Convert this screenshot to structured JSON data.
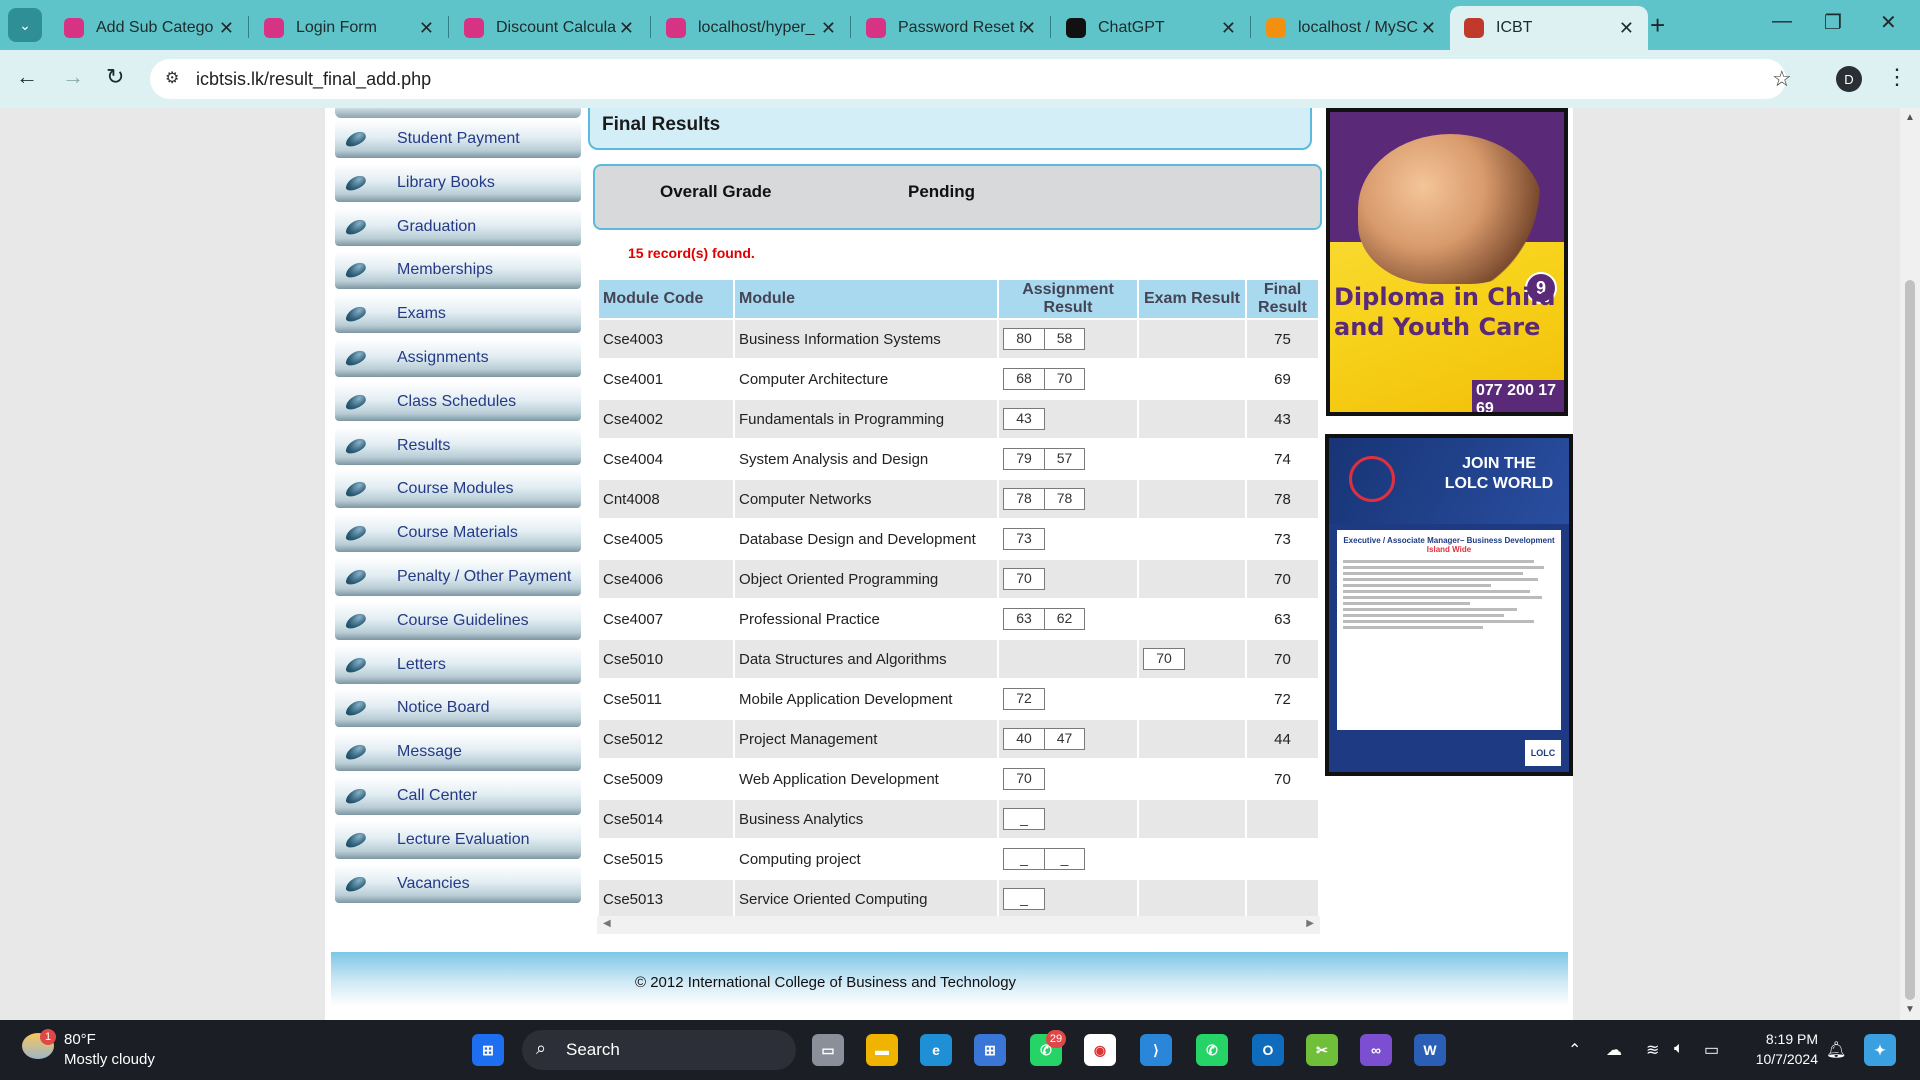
{
  "browser": {
    "tabs": [
      {
        "title": "Add Sub Catego",
        "icon": "admin-icon",
        "color": "#d63384"
      },
      {
        "title": "Login Form",
        "icon": "admin-icon",
        "color": "#d63384"
      },
      {
        "title": "Discount Calcula",
        "icon": "admin-icon",
        "color": "#d63384"
      },
      {
        "title": "localhost/hyper_",
        "icon": "admin-icon",
        "color": "#d63384"
      },
      {
        "title": "Password Reset F",
        "icon": "admin-icon",
        "color": "#d63384"
      },
      {
        "title": "ChatGPT",
        "icon": "chatgpt-icon",
        "color": "#111111"
      },
      {
        "title": "localhost / MySC",
        "icon": "phpmyadmin-icon",
        "color": "#f29111"
      },
      {
        "title": "ICBT",
        "icon": "icbt-icon",
        "color": "#c0392b"
      }
    ],
    "url": "icbtsis.lk/result_final_add.php",
    "profile_initial": "D"
  },
  "sidebar": {
    "items": [
      {
        "label": "Student Payment"
      },
      {
        "label": "Library Books"
      },
      {
        "label": "Graduation"
      },
      {
        "label": "Memberships"
      },
      {
        "label": "Exams"
      },
      {
        "label": "Assignments"
      },
      {
        "label": "Class Schedules"
      },
      {
        "label": "Results"
      },
      {
        "label": "Course Modules"
      },
      {
        "label": "Course Materials"
      },
      {
        "label": "Penalty / Other Payment"
      },
      {
        "label": "Course Guidelines"
      },
      {
        "label": "Letters"
      },
      {
        "label": "Notice Board"
      },
      {
        "label": "Message"
      },
      {
        "label": "Call Center"
      },
      {
        "label": "Lecture Evaluation"
      },
      {
        "label": "Vacancies"
      }
    ]
  },
  "main": {
    "title": "Final Results",
    "overall_grade_label": "Overall Grade",
    "overall_grade_value": "Pending",
    "records_found": "15 record(s) found.",
    "columns": [
      "Module Code",
      "Module",
      "Assignment Result",
      "Exam Result",
      "Final Result"
    ],
    "rows": [
      {
        "code": "Cse4003",
        "module": "Business Information Systems",
        "assignment": [
          "80",
          "58"
        ],
        "exam": [],
        "final": "75"
      },
      {
        "code": "Cse4001",
        "module": "Computer Architecture",
        "assignment": [
          "68",
          "70"
        ],
        "exam": [],
        "final": "69"
      },
      {
        "code": "Cse4002",
        "module": "Fundamentals in Programming",
        "assignment": [
          "43"
        ],
        "exam": [],
        "final": "43"
      },
      {
        "code": "Cse4004",
        "module": "System Analysis and Design",
        "assignment": [
          "79",
          "57"
        ],
        "exam": [],
        "final": "74"
      },
      {
        "code": "Cnt4008",
        "module": "Computer Networks",
        "assignment": [
          "78",
          "78"
        ],
        "exam": [],
        "final": "78"
      },
      {
        "code": "Cse4005",
        "module": "Database Design and Development",
        "assignment": [
          "73"
        ],
        "exam": [],
        "final": "73"
      },
      {
        "code": "Cse4006",
        "module": "Object Oriented Programming",
        "assignment": [
          "70"
        ],
        "exam": [],
        "final": "70"
      },
      {
        "code": "Cse4007",
        "module": "Professional Practice",
        "assignment": [
          "63",
          "62"
        ],
        "exam": [],
        "final": "63"
      },
      {
        "code": "Cse5010",
        "module": "Data Structures and Algorithms",
        "assignment": [],
        "exam": [
          "70"
        ],
        "final": "70"
      },
      {
        "code": "Cse5011",
        "module": "Mobile Application Development",
        "assignment": [
          "72"
        ],
        "exam": [],
        "final": "72"
      },
      {
        "code": "Cse5012",
        "module": "Project Management",
        "assignment": [
          "40",
          "47"
        ],
        "exam": [],
        "final": "44"
      },
      {
        "code": "Cse5009",
        "module": "Web Application Development",
        "assignment": [
          "70"
        ],
        "exam": [],
        "final": "70"
      },
      {
        "code": "Cse5014",
        "module": "Business Analytics",
        "assignment": [
          "_"
        ],
        "exam": [],
        "final": ""
      },
      {
        "code": "Cse5015",
        "module": "Computing project",
        "assignment": [
          "_",
          "_"
        ],
        "exam": [],
        "final": ""
      },
      {
        "code": "Cse5013",
        "module": "Service Oriented Computing",
        "assignment": [
          "_"
        ],
        "exam": [],
        "final": ""
      }
    ]
  },
  "ads": {
    "ad1": {
      "headline": "Diploma in Child and Youth Care",
      "phone": "077 200 17 69",
      "badge": "9"
    },
    "ad2": {
      "headline": "JOIN THE LOLC WORLD",
      "job_title": "Executive / Associate Manager– Business Development",
      "location": "Island Wide",
      "logo": "LOLC"
    }
  },
  "footer": {
    "copyright": "© 2012 International College of Business and Technology"
  },
  "taskbar": {
    "weather_temp": "80°F",
    "weather_desc": "Mostly cloudy",
    "weather_badge": "1",
    "search_placeholder": "Search",
    "whatsapp_badge": "29",
    "time": "8:19 PM",
    "date": "10/7/2024"
  }
}
